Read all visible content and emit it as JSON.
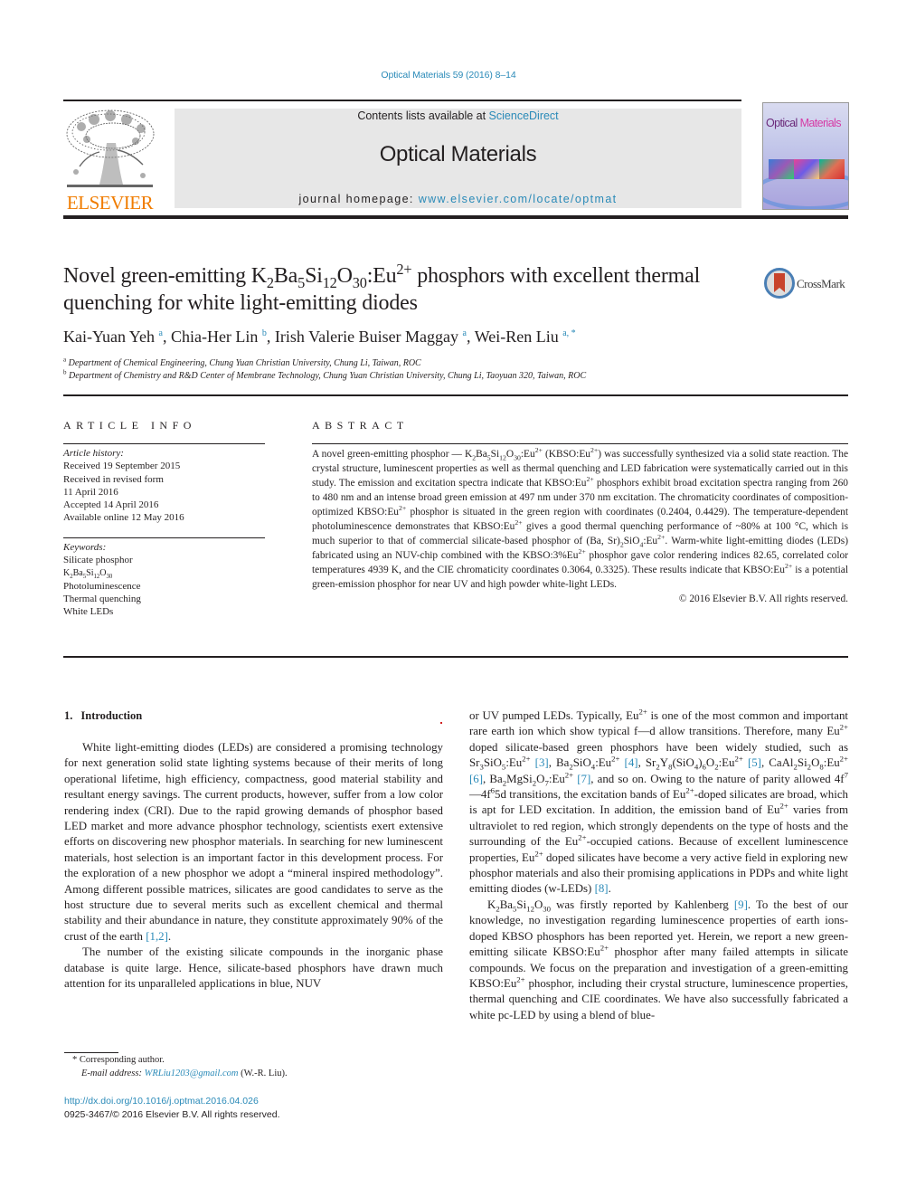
{
  "header": {
    "journal_ref": "Optical Materials 59 (2016) 8–14",
    "contents_prefix": "Contents lists available at ",
    "contents_link": "ScienceDirect",
    "journal_title": "Optical Materials",
    "homepage_prefix": "journal homepage: ",
    "homepage_link": "www.elsevier.com/locate/optmat",
    "publisher_logo": "ELSEVIER",
    "cover_title_a": "Optical ",
    "cover_title_b": "Materials",
    "publisher_color": "#f07c00",
    "link_color": "#2a8ab8"
  },
  "article": {
    "title_parts": {
      "pre": "Novel green-emitting K",
      "k_sub": "2",
      "ba": "Ba",
      "ba_sub": "5",
      "si": "Si",
      "si_sub": "12",
      "o": "O",
      "o_sub": "30",
      "eu": ":Eu",
      "eu_sup": "2+",
      "post": " phosphors with excellent thermal quenching for white light-emitting diodes"
    },
    "crossmark_label": "CrossMark",
    "authors": [
      {
        "name": "Kai-Yuan Yeh",
        "affil": "a"
      },
      {
        "name": "Chia-Her Lin",
        "affil": "b"
      },
      {
        "name": "Irish Valerie Buiser Maggay",
        "affil": "a"
      },
      {
        "name": "Wei-Ren Liu",
        "affil": "a, *"
      }
    ],
    "affiliations": [
      {
        "key": "a",
        "text": "Department of Chemical Engineering, Chung Yuan Christian University, Chung Li, Taiwan, ROC"
      },
      {
        "key": "b",
        "text": "Department of Chemistry and R&D Center of Membrane Technology, Chung Yuan Christian University, Chung Li, Taoyuan 320, Taiwan, ROC"
      }
    ]
  },
  "article_info": {
    "heading": "ARTICLE INFO",
    "history_label": "Article history:",
    "history": [
      "Received 19 September 2015",
      "Received in revised form",
      "11 April 2016",
      "Accepted 14 April 2016",
      "Available online 12 May 2016"
    ],
    "keywords_label": "Keywords:",
    "keywords": [
      "Silicate phosphor",
      "K2Ba5Si12O30",
      "Photoluminescence",
      "Thermal quenching",
      "White LEDs"
    ]
  },
  "abstract": {
    "heading": "ABSTRACT",
    "s1": "A novel green-emitting phosphor — K",
    "s2": " (KBSO:Eu",
    "s3": ") was successfully synthesized via a solid state reaction. The crystal structure, luminescent properties as well as thermal quenching and LED fabrication were systematically carried out in this study. The emission and excitation spectra indicate that KBSO:Eu",
    "s4": " phosphors exhibit broad excitation spectra ranging from 260 to 480 nm and an intense broad green emission at 497 nm under 370 nm excitation. The chromaticity coordinates of composition-optimized KBSO:Eu",
    "s5": " phosphor is situated in the green region with coordinates (0.2404, 0.4429). The temperature-dependent photoluminescence demonstrates that KBSO:Eu",
    "s6": " gives a good thermal quenching performance of ~80% at 100 °C, which is much superior to that of commercial silicate-based phosphor of (Ba, Sr)",
    "s7": ". Warm-white light-emitting diodes (LEDs) fabricated using an NUV-chip combined with the KBSO:3%Eu",
    "s8": " phosphor gave color rendering indices 82.65, correlated color temperatures 4939 K, and the CIE chromaticity coordinates 0.3064, 0.3325). These results indicate that KBSO:Eu",
    "s9": " is a potential green-emission phosphor for near UV and high powder white-light LEDs.",
    "copyright": "© 2016 Elsevier B.V. All rights reserved."
  },
  "intro": {
    "number": "1.",
    "heading": "Introduction",
    "p1": "White light-emitting diodes (LEDs) are considered a promising technology for next generation solid state lighting systems because of their merits of long operational lifetime, high efficiency, compactness, good material stability and resultant energy savings. The current products, however, suffer from a low color rendering index (CRI). Due to the rapid growing demands of phosphor based LED market and more advance phosphor technology, scientists exert extensive efforts on discovering new phosphor materials. In searching for new luminescent materials, host selection is an important factor in this development process. For the exploration of a new phosphor we adopt a “mineral inspired methodology”. Among different possible matrices, silicates are good candidates to serve as the host structure due to several merits such as excellent chemical and thermal stability and their abundance in nature, they constitute approximately 90% of the crust of the earth ",
    "p1_ref": "[1,2]",
    "p2": "The number of the existing silicate compounds in the inorganic phase database is quite large. Hence, silicate-based phosphors have drawn much attention for its unparalleled applications in blue, NUV",
    "r1": "or UV pumped LEDs. Typically, Eu",
    "r2": " is one of the most common and important rare earth ion which show typical f—d allow transitions. Therefore, many Eu",
    "r3": " doped silicate-based green phosphors have been widely studied, such as Sr",
    "ref3": "[3]",
    "ref4": "[4]",
    "ref5": "[5]",
    "ref6": "[6]",
    "ref7": "[7]",
    "r4": ", and so on. Owing to the nature of parity allowed 4f",
    "r5": "—4f",
    "r6": "5d transitions, the excitation bands of Eu",
    "r7": "-doped silicates are broad, which is apt for LED excitation. In addition, the emission band of Eu",
    "r8": " varies from ultraviolet to red region, which strongly dependents on the type of hosts and the surrounding of the Eu",
    "r9": "-occupied cations. Because of excellent luminescence properties, Eu",
    "r10": " doped silicates have become a very active field in exploring new phosphor materials and also their promising applications in PDPs and white light emitting diodes (w-LEDs) ",
    "ref8": "[8]",
    "q1": " was firstly reported by Kahlenberg ",
    "ref9": "[9]",
    "q2": ". To the best of our knowledge, no investigation regarding luminescence properties of earth ions-doped KBSO phosphors has been reported yet. Herein, we report a new green-emitting silicate KBSO:Eu",
    "q3": " phosphor after many failed attempts in silicate compounds. We focus on the preparation and investigation of a green-emitting KBSO:Eu",
    "q4": " phosphor, including their crystal structure, luminescence properties, thermal quenching and CIE coordinates. We have also successfully fabricated a white pc-LED by using a blend of blue-"
  },
  "footnotes": {
    "corresponding": "* Corresponding author.",
    "email_label": "E-mail address: ",
    "email": "WRLiu1203@gmail.com",
    "email_suffix": " (W.-R. Liu).",
    "doi": "http://dx.doi.org/10.1016/j.optmat.2016.04.026",
    "issn": "0925-3467/© 2016 Elsevier B.V. All rights reserved."
  }
}
